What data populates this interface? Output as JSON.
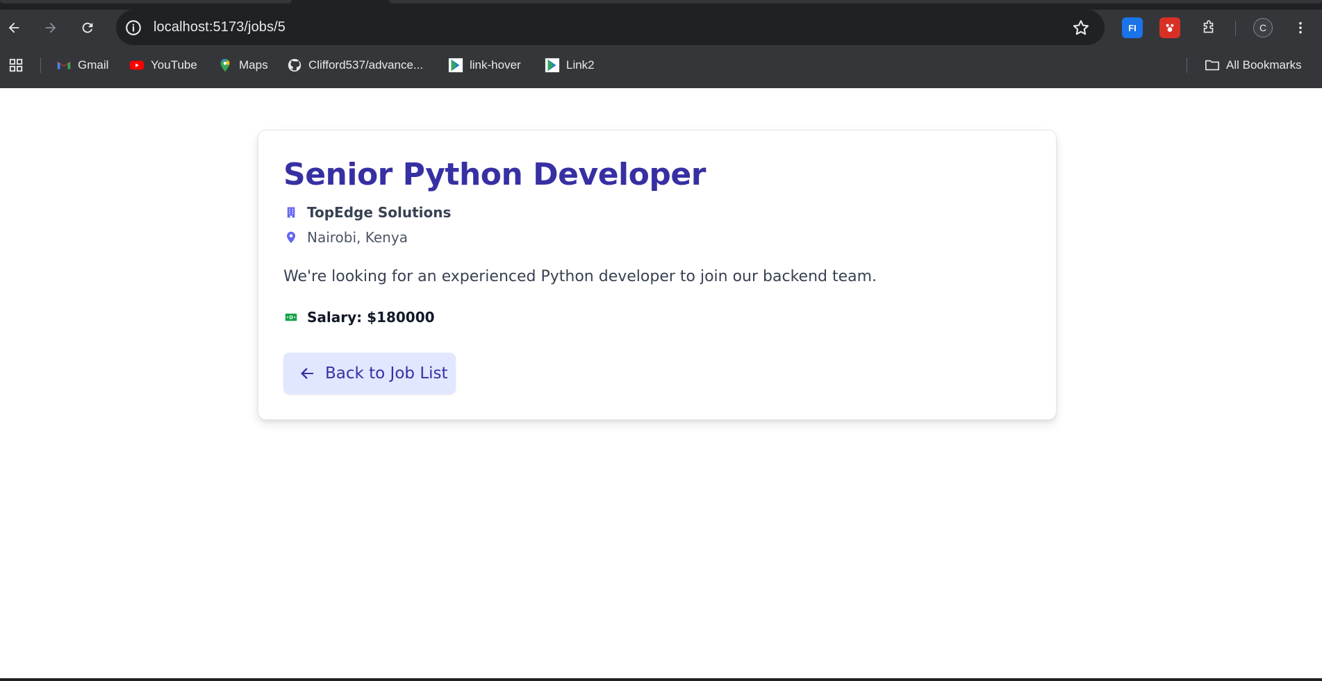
{
  "browser": {
    "url": "localhost:5173/jobs/5",
    "profile_initial": "C",
    "extensions": [
      {
        "name": "FI",
        "color": "#1a73e8"
      },
      {
        "name": "color-extension",
        "color": "#d93025"
      }
    ],
    "bookmarks": [
      {
        "label": "Gmail",
        "icon": "gmail-icon"
      },
      {
        "label": "YouTube",
        "icon": "youtube-icon"
      },
      {
        "label": "Maps",
        "icon": "maps-icon"
      },
      {
        "label": "Clifford537/advance...",
        "icon": "github-icon"
      },
      {
        "label": "link-hover",
        "icon": "play-logo-icon"
      },
      {
        "label": "Link2",
        "icon": "play-logo-icon"
      }
    ],
    "all_bookmarks_label": "All Bookmarks"
  },
  "job": {
    "title": "Senior Python Developer",
    "company": "TopEdge Solutions",
    "location": "Nairobi, Kenya",
    "description": "We're looking for an experienced Python developer to join our backend team.",
    "salary": "Salary: $180000",
    "back_label": "Back to Job List"
  },
  "colors": {
    "accent": "#3730a3",
    "icon_accent": "#6366f1",
    "salary_icon": "#16a34a",
    "button_bg": "#e0e7ff"
  }
}
